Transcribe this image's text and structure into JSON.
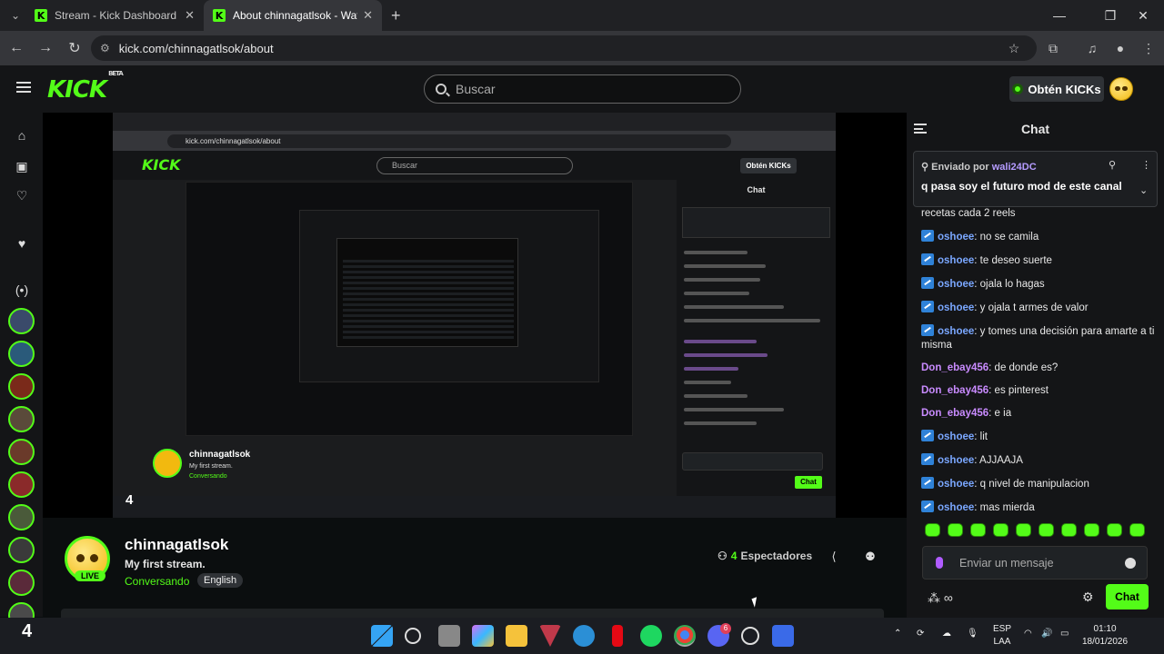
{
  "browser": {
    "tabs": [
      {
        "title": "Stream - Kick Dashboard",
        "active": false
      },
      {
        "title": "About chinnagatlsok - Watch Li",
        "active": true
      }
    ],
    "url": "kick.com/chinnagatlsok/about"
  },
  "header": {
    "logo": "KICK",
    "logo_badge": "BETA",
    "search_placeholder": "Buscar",
    "kicks_button": "Obtén KICKs"
  },
  "stream_overlay_number": "4",
  "channel": {
    "name": "chinnagatlsok",
    "live_badge": "LIVE",
    "title": "My first stream.",
    "category": "Conversando",
    "tag": "English",
    "viewers_count": "4",
    "viewers_label": "Espectadores"
  },
  "chat": {
    "title": "Chat",
    "pinned": {
      "sent_by_label": "Enviado por",
      "user": "wali24DC",
      "message": "q pasa soy el futuro mod de este canal"
    },
    "messages": [
      {
        "user": "",
        "text": "recetas cada 2 reels",
        "badge": false
      },
      {
        "user": "oshoee",
        "text": "no se camila",
        "badge": true
      },
      {
        "user": "oshoee",
        "text": "te deseo suerte",
        "badge": true
      },
      {
        "user": "oshoee",
        "text": "ojala lo hagas",
        "badge": true
      },
      {
        "user": "oshoee",
        "text": "y ojala t armes de valor",
        "badge": true
      },
      {
        "user": "oshoee",
        "text": "y tomes una decisión para amarte a ti misma",
        "badge": true
      },
      {
        "user": "Don_ebay456",
        "text": "de donde es?",
        "badge": false
      },
      {
        "user": "Don_ebay456",
        "text": "es pinterest",
        "badge": false
      },
      {
        "user": "Don_ebay456",
        "text": "e ia",
        "badge": false
      },
      {
        "user": "oshoee",
        "text": "lit",
        "badge": true
      },
      {
        "user": "oshoee",
        "text": "AJJAAJA",
        "badge": true
      },
      {
        "user": "oshoee",
        "text": "q nivel de manipulacion",
        "badge": true
      },
      {
        "user": "oshoee",
        "text": "mas mierda",
        "badge": true
      }
    ],
    "input_placeholder": "Enviar un mensaje",
    "send_button": "Chat"
  },
  "taskbar": {
    "language_line1": "ESP",
    "language_line2": "LAA",
    "time": "01:10",
    "date": "18/01/2026",
    "desktop_number": "4",
    "discord_badge": "6"
  },
  "colors": {
    "brand_green": "#53fc18",
    "background": "#0b0e0f",
    "panel": "#141517"
  }
}
